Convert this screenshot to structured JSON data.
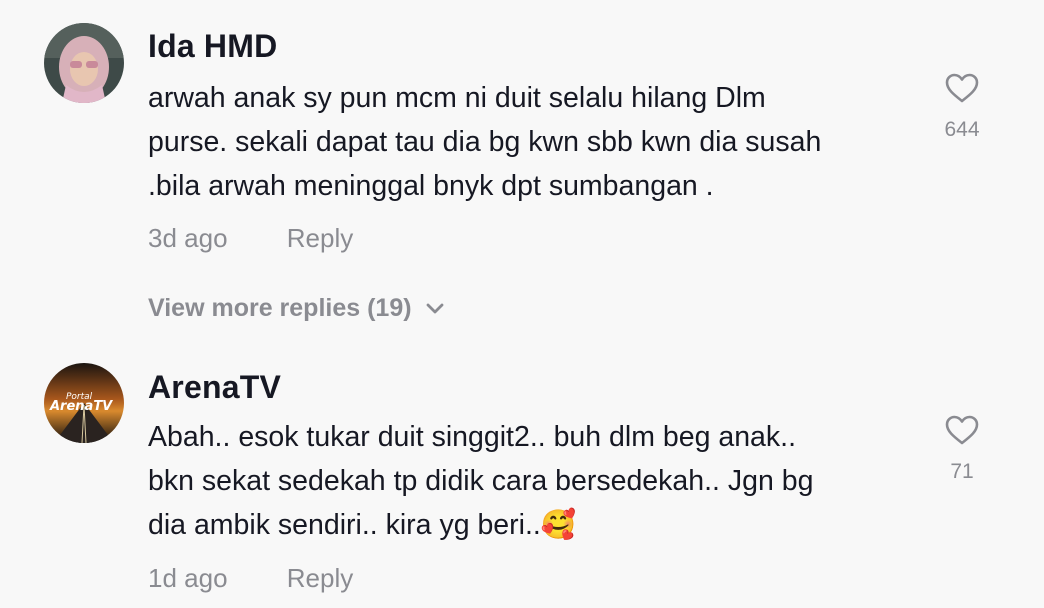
{
  "comments": [
    {
      "username": "Ida HMD",
      "text_lines": [
        "arwah anak sy pun mcm ni duit selalu hilang Dlm",
        "purse. sekali dapat tau dia bg kwn sbb kwn dia susah",
        ".bila arwah meninggal bnyk dpt sumbangan ."
      ],
      "time": "3d ago",
      "reply_label": "Reply",
      "like_count": "644",
      "avatar_icon": "woman-hijab-avatar",
      "like_icon": "heart-outline-icon"
    },
    {
      "username": "ArenaTV",
      "text_lines": [
        "Abah.. esok tukar duit singgit2.. buh dlm beg anak..",
        "bkn sekat sedekah tp didik cara bersedekah.. Jgn bg",
        "dia ambik sendiri.. kira yg beri..🥰"
      ],
      "time": "1d ago",
      "reply_label": "Reply",
      "like_count": "71",
      "avatar_icon": "portal-arenatv-logo",
      "avatar_logo_line1": "Portal",
      "avatar_logo_line2": "ArenaTV",
      "like_icon": "heart-outline-icon"
    }
  ],
  "view_more_replies": "View more replies (19)",
  "chevron_icon": "chevron-down-icon",
  "colors": {
    "background": "#f8f8f8",
    "primary_text": "#161823",
    "secondary_text": "#8a8b91"
  }
}
